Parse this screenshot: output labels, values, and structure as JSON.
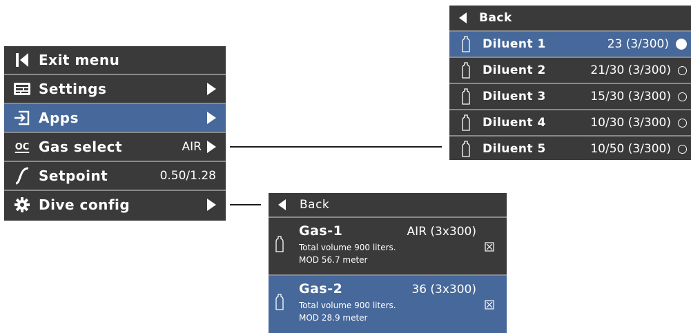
{
  "main_menu": {
    "items": [
      {
        "icon": "exit-bar-icon",
        "label": "Exit menu",
        "value": "",
        "arrow": false
      },
      {
        "icon": "settings-icon",
        "label": "Settings",
        "value": "",
        "arrow": true
      },
      {
        "icon": "apps-icon",
        "label": "Apps",
        "value": "",
        "arrow": true,
        "highlighted": true
      },
      {
        "icon": "oc-icon",
        "icon_text": "OC",
        "label": "Gas select",
        "value": "AIR",
        "arrow": true
      },
      {
        "icon": "setpoint-curve-icon",
        "label": "Setpoint",
        "value": "0.50/1.28",
        "arrow": false
      },
      {
        "icon": "gear-icon",
        "label": "Dive config",
        "value": "",
        "arrow": true
      }
    ]
  },
  "diluent_menu": {
    "back_label": "Back",
    "items": [
      {
        "label": "Diluent 1",
        "value": "23 (3/300)",
        "selected": true
      },
      {
        "label": "Diluent 2",
        "value": "21/30 (3/300)",
        "selected": false
      },
      {
        "label": "Diluent 3",
        "value": "15/30 (3/300)",
        "selected": false
      },
      {
        "label": "Diluent 4",
        "value": "10/30 (3/300)",
        "selected": false
      },
      {
        "label": "Diluent 5",
        "value": "10/50 (3/300)",
        "selected": false
      }
    ]
  },
  "gas_menu": {
    "back_label": "Back",
    "items": [
      {
        "name": "Gas-1",
        "mix": "AIR (3x300)",
        "volume": "Total volume 900 liters.",
        "mod": "MOD 56.7 meter"
      },
      {
        "name": "Gas-2",
        "mix": "36 (3x300)",
        "volume": "Total volume 900 liters.",
        "mod": "MOD 28.9 meter"
      }
    ]
  },
  "colors": {
    "panel": "#3a3a3a",
    "highlight": "#46689a",
    "separator": "#8a8a8a"
  }
}
